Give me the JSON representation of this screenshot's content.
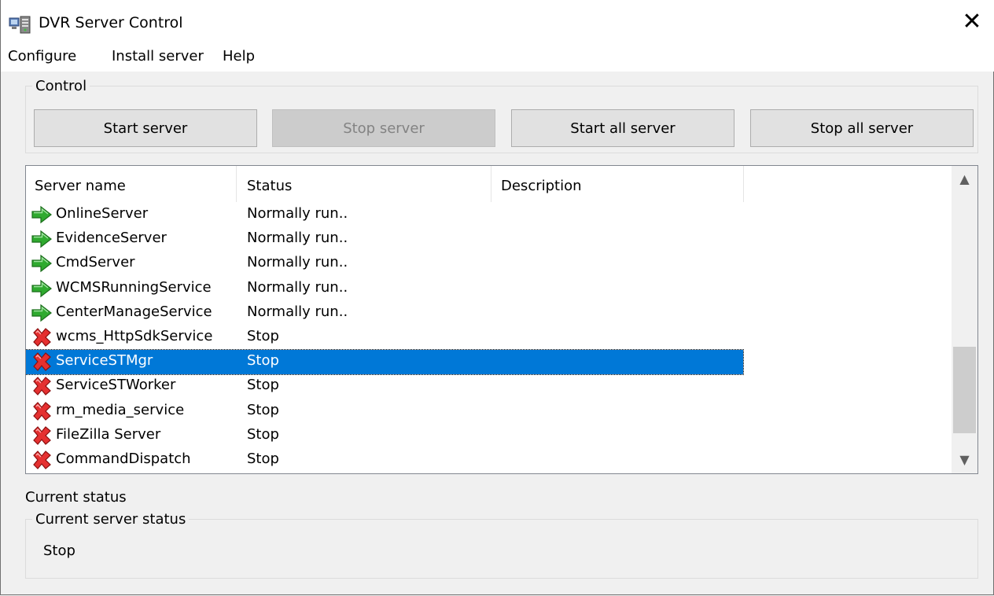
{
  "window": {
    "title": "DVR Server Control",
    "close_glyph": "✕"
  },
  "menu": [
    "Configure",
    "Install server",
    "Help"
  ],
  "control": {
    "legend": "Control",
    "buttons": {
      "start": "Start server",
      "stop": "Stop server",
      "start_all": "Start all server",
      "stop_all": "Stop all server"
    }
  },
  "list": {
    "columns": [
      "Server name",
      "Status",
      "Description"
    ],
    "rows": [
      {
        "name": "OnlineServer",
        "status": "Normally run..",
        "icon": "green-arrow-icon",
        "selected": false
      },
      {
        "name": "EvidenceServer",
        "status": "Normally run..",
        "icon": "green-arrow-icon",
        "selected": false
      },
      {
        "name": "CmdServer",
        "status": "Normally run..",
        "icon": "green-arrow-icon",
        "selected": false
      },
      {
        "name": "WCMSRunningService",
        "status": "Normally run..",
        "icon": "green-arrow-icon",
        "selected": false
      },
      {
        "name": "CenterManageService",
        "status": "Normally run..",
        "icon": "green-arrow-icon",
        "selected": false
      },
      {
        "name": "wcms_HttpSdkService",
        "status": "Stop",
        "icon": "red-x-icon",
        "selected": false
      },
      {
        "name": "ServiceSTMgr",
        "status": "Stop",
        "icon": "red-x-icon",
        "selected": true
      },
      {
        "name": "ServiceSTWorker",
        "status": "Stop",
        "icon": "red-x-icon",
        "selected": false
      },
      {
        "name": "rm_media_service",
        "status": "Stop",
        "icon": "red-x-icon",
        "selected": false
      },
      {
        "name": "FileZilla Server",
        "status": "Stop",
        "icon": "red-x-icon",
        "selected": false
      },
      {
        "name": "CommandDispatch",
        "status": "Stop",
        "icon": "red-x-icon",
        "selected": false
      }
    ]
  },
  "current": {
    "label": "Current status",
    "legend": "Current server status",
    "value": "Stop"
  },
  "colors": {
    "selection": "#0078d7",
    "running": "#22a822",
    "stopped": "#e02020"
  }
}
